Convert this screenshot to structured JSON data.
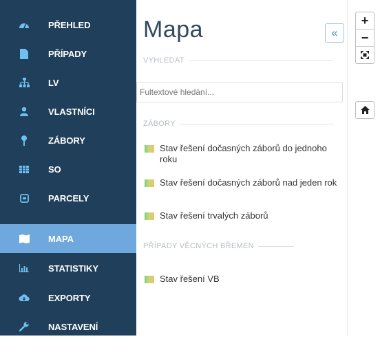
{
  "sidebar": {
    "items": [
      {
        "label": "PŘEHLED",
        "icon": "dashboard-icon"
      },
      {
        "label": "PŘÍPADY",
        "icon": "document-icon"
      },
      {
        "label": "LV",
        "icon": "sitemap-icon"
      },
      {
        "label": "VLASTNÍCI",
        "icon": "user-icon"
      },
      {
        "label": "ZÁBORY",
        "icon": "pin-icon"
      },
      {
        "label": "SO",
        "icon": "grid-icon"
      },
      {
        "label": "PARCELY",
        "icon": "square-icon"
      },
      {
        "label": "MAPA",
        "icon": "map-icon"
      },
      {
        "label": "STATISTIKY",
        "icon": "bar-chart-icon"
      },
      {
        "label": "EXPORTY",
        "icon": "cloud-download-icon"
      },
      {
        "label": "NASTAVENÍ",
        "icon": "wrench-icon"
      }
    ],
    "active": "MAPA"
  },
  "panel": {
    "title": "Mapa",
    "collapse_label": "«",
    "search": {
      "section_label": "VYHLEDAT",
      "value": "",
      "placeholder": "Fultextové hledání..."
    },
    "zabory": {
      "section_label": "ZÁBORY",
      "layers": [
        "Stav řešení dočasných záborů do jednoho roku",
        "Stav řešení dočasných záborů nad jeden rok",
        "Stav řešení trvalých záborů"
      ]
    },
    "vb": {
      "section_label": "PŘÍPADY VĚCNÝCH BŘEMEN",
      "layers": [
        "Stav řešení VB"
      ]
    }
  },
  "map_controls": {
    "zoom_in": "+",
    "zoom_out": "−",
    "fullscreen_icon": "expand-icon",
    "home_icon": "home-icon"
  },
  "colors": {
    "sidebar_bg": "#1f3f5b",
    "active_bg": "#6fa8dc",
    "icon_color": "#6fc0f0"
  }
}
